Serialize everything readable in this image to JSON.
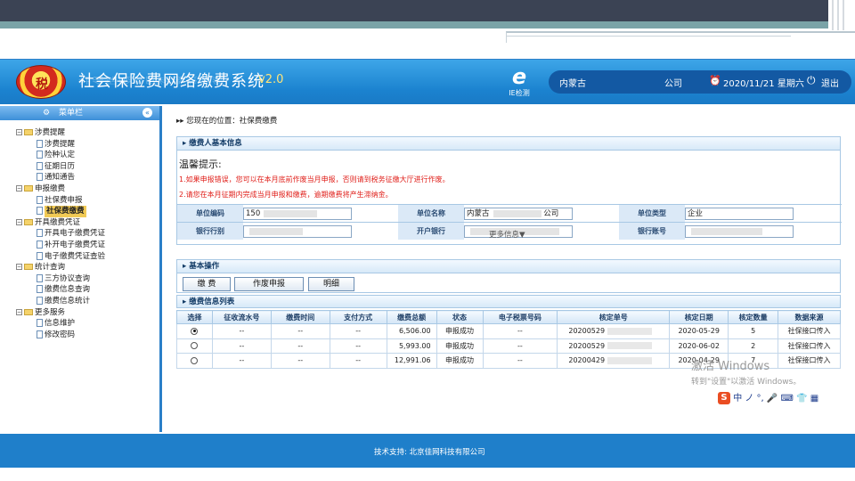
{
  "header": {
    "title": "社会保险费网络缴费系统",
    "version": "v2.0",
    "ie_check_label": "IE检测",
    "region": "内蒙古",
    "company": "公司",
    "datetime": "2020/11/21 星期六",
    "logout": "退出"
  },
  "sidebar": {
    "title": "菜单栏",
    "collapse_glyph": "«",
    "groups": [
      {
        "label": "涉费提醒",
        "items": [
          "涉费提醒",
          "险种认定",
          "征期日历",
          "通知通告"
        ]
      },
      {
        "label": "申报缴费",
        "items": [
          "社保费申报",
          "社保费缴费"
        ]
      },
      {
        "label": "开具缴费凭证",
        "items": [
          "开具电子缴费凭证",
          "补开电子缴费凭证",
          "电子缴费凭证查验"
        ]
      },
      {
        "label": "统计查询",
        "items": [
          "三方协议查询",
          "缴费信息查询",
          "缴费信息统计"
        ]
      },
      {
        "label": "更多服务",
        "items": [
          "信息维护",
          "修改密码"
        ]
      }
    ],
    "selected": "社保费缴费"
  },
  "breadcrumb": "您现在的位置：社保费缴费",
  "payer": {
    "section_title": "缴费人基本信息",
    "notice_title": "温馨提示:",
    "notice_1": "1.如果申报错误，您可以在本月底前作废当月申报，否则请到税务征缴大厅进行作废。",
    "notice_2": "2.请您在本月征期内完成当月申报和缴费，逾期缴费将产生滞纳金。",
    "fields": {
      "unit_code_label": "单位编码",
      "unit_code": "150",
      "unit_name_label": "单位名称",
      "unit_name_prefix": "内蒙古",
      "unit_name_suffix": "公司",
      "unit_type_label": "单位类型",
      "unit_type": "企业",
      "bank_branch_label": "银行行别",
      "bank_branch": "",
      "open_bank_label": "开户银行",
      "open_bank": "",
      "bank_account_label": "银行账号",
      "bank_account": ""
    },
    "more_info": "更多信息▼"
  },
  "operations": {
    "section_title": "基本操作",
    "pay": "缴 费",
    "void": "作废申报",
    "detail": "明细"
  },
  "list": {
    "section_title": "缴费信息列表",
    "columns": [
      "选择",
      "征收流水号",
      "缴费时间",
      "支付方式",
      "缴费总额",
      "状态",
      "电子税票号码",
      "核定单号",
      "核定日期",
      "核定数量",
      "数据来源"
    ],
    "rows": [
      {
        "selected": true,
        "serial": "--",
        "time": "--",
        "method": "--",
        "amount": "6,506.00",
        "status": "申报成功",
        "ticket": "--",
        "order_no": "20200529",
        "date": "2020-05-29",
        "count": "5",
        "source": "社保接口传入"
      },
      {
        "selected": false,
        "serial": "--",
        "time": "--",
        "method": "--",
        "amount": "5,993.00",
        "status": "申报成功",
        "ticket": "--",
        "order_no": "20200529",
        "date": "2020-06-02",
        "count": "2",
        "source": "社保接口传入"
      },
      {
        "selected": false,
        "serial": "--",
        "time": "--",
        "method": "--",
        "amount": "12,991.06",
        "status": "申报成功",
        "ticket": "--",
        "order_no": "20200429",
        "date": "2020-04-29",
        "count": "7",
        "source": "社保接口传入"
      }
    ]
  },
  "footer": {
    "support": "技术支持: 北京佳网科技有限公司"
  },
  "os": {
    "activate_title": "激活 Windows",
    "activate_hint": "转到\"设置\"以激活 Windows。",
    "ime": "中 ノ °, 🎤 ⌨ 👕 ▦"
  },
  "colors": {
    "header_blue": "#1b82cf",
    "footer_blue": "#1f7fca",
    "warning_red": "#e0201b",
    "selected_menu": "#f1ca55"
  }
}
